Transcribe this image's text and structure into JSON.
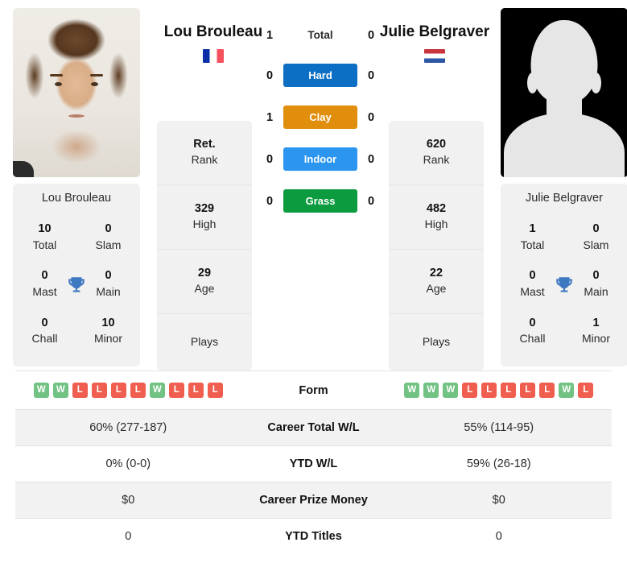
{
  "players": {
    "left": {
      "name": "Lou Brouleau",
      "flag": "france-flag",
      "card_name": "Lou Brouleau",
      "titles": {
        "total_value": "10",
        "total_label": "Total",
        "slam_value": "0",
        "slam_label": "Slam",
        "mast_value": "0",
        "mast_label": "Mast",
        "main_value": "0",
        "main_label": "Main",
        "chall_value": "0",
        "chall_label": "Chall",
        "minor_value": "10",
        "minor_label": "Minor"
      },
      "rank": {
        "rank_value": "Ret.",
        "rank_label": "Rank",
        "high_value": "329",
        "high_label": "High",
        "age_value": "29",
        "age_label": "Age",
        "plays_label": "Plays"
      },
      "form": [
        "W",
        "W",
        "L",
        "L",
        "L",
        "L",
        "W",
        "L",
        "L",
        "L"
      ],
      "career_total_wl": "60% (277-187)",
      "ytd_wl": "0% (0-0)",
      "career_prize_money": "$0",
      "ytd_titles": "0"
    },
    "right": {
      "name": "Julie Belgraver",
      "flag": "netherlands-flag",
      "card_name": "Julie Belgraver",
      "titles": {
        "total_value": "1",
        "total_label": "Total",
        "slam_value": "0",
        "slam_label": "Slam",
        "mast_value": "0",
        "mast_label": "Mast",
        "main_value": "0",
        "main_label": "Main",
        "chall_value": "0",
        "chall_label": "Chall",
        "minor_value": "1",
        "minor_label": "Minor"
      },
      "rank": {
        "rank_value": "620",
        "rank_label": "Rank",
        "high_value": "482",
        "high_label": "High",
        "age_value": "22",
        "age_label": "Age",
        "plays_label": "Plays"
      },
      "form": [
        "W",
        "W",
        "W",
        "L",
        "L",
        "L",
        "L",
        "L",
        "W",
        "L"
      ],
      "career_total_wl": "55% (114-95)",
      "ytd_wl": "59% (26-18)",
      "career_prize_money": "$0",
      "ytd_titles": "0"
    }
  },
  "h2h": {
    "rows": [
      {
        "label": "Total",
        "left": "1",
        "right": "0",
        "color": ""
      },
      {
        "label": "Hard",
        "left": "0",
        "right": "0",
        "color": "#0c6fc4"
      },
      {
        "label": "Clay",
        "left": "1",
        "right": "0",
        "color": "#e08e0b"
      },
      {
        "label": "Indoor",
        "left": "0",
        "right": "0",
        "color": "#2b95ef"
      },
      {
        "label": "Grass",
        "left": "0",
        "right": "0",
        "color": "#0d9b3f"
      }
    ]
  },
  "stats_rows": [
    {
      "label": "Form"
    },
    {
      "label": "Career Total W/L"
    },
    {
      "label": "YTD W/L"
    },
    {
      "label": "Career Prize Money"
    },
    {
      "label": "YTD Titles"
    }
  ],
  "colors": {
    "win": "#72c283",
    "loss": "#ef5e4e",
    "card_bg": "#f1f1f1",
    "row_shade": "#f2f2f2"
  }
}
